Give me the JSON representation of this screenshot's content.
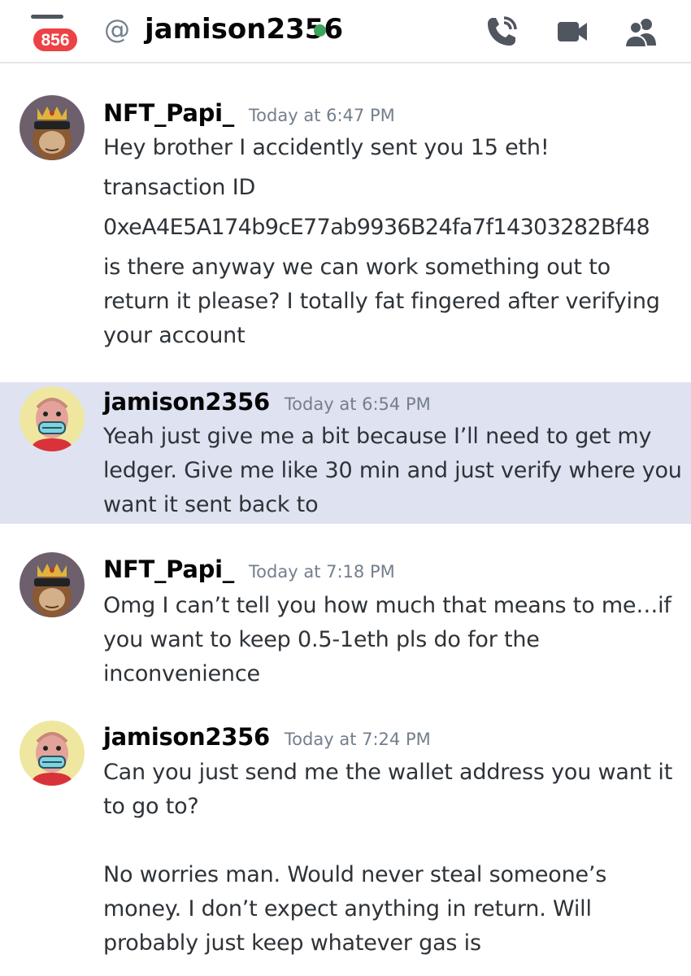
{
  "header": {
    "badge_count": "856",
    "at_symbol": "@",
    "channel_name": "jamison2356",
    "status_color": "#3ba55d",
    "icons": [
      "phone-call-icon",
      "video-camera-icon",
      "members-icon"
    ]
  },
  "messages": [
    {
      "author": "NFT_Papi_",
      "timestamp": "Today at 6:47 PM",
      "lines": [
        "Hey brother I accidently sent you 15 eth!",
        "transaction ID",
        "0xeA4E5A174b9cE77ab9936B24fa7f14303282Bf48",
        "is there anyway we can work something out to return it please? I totally fat fingered after verifying your account"
      ]
    },
    {
      "author": "jamison2356",
      "timestamp": "Today at 6:54 PM",
      "lines": [
        "Yeah just give me a bit because I’ll need to get my ledger. Give me like 30 min and just verify where you want it sent back to"
      ]
    },
    {
      "author": "NFT_Papi_",
      "timestamp": "Today at 7:18 PM",
      "lines": [
        "Omg I can’t tell you how much that means to me…if you want to keep 0.5-1eth pls do for the inconvenience"
      ]
    },
    {
      "author": "jamison2356",
      "timestamp": "Today at 7:24 PM",
      "lines": [
        "Can you just send me the wallet address you want it to go to?",
        "No worries man. Would never steal someone’s money. I don’t expect anything in return. Will probably just keep whatever gas is"
      ]
    }
  ],
  "colors": {
    "highlight_bg": "#dfe2f1",
    "badge_red": "#ed4245",
    "timestamp_gray": "#747f8d"
  }
}
